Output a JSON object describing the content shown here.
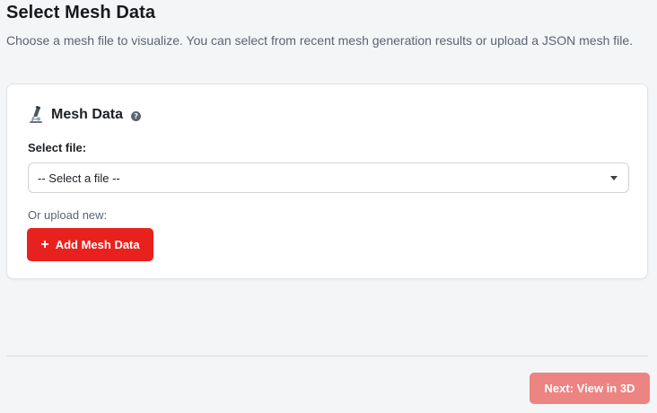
{
  "page": {
    "title": "Select Mesh Data",
    "description": "Choose a mesh file to visualize. You can select from recent mesh generation results or upload a JSON mesh file."
  },
  "card": {
    "icon": "microscope-icon",
    "title": "Mesh Data",
    "help_icon": "question-circle-icon",
    "help_glyph": "?",
    "select_label": "Select file:",
    "select_value": "-- Select a file --",
    "upload_label": "Or upload new:",
    "add_button_icon": "plus-icon",
    "add_button_glyph": "+",
    "add_button_label": "Add Mesh Data"
  },
  "footer": {
    "next_button_label": "Next: View in 3D"
  },
  "colors": {
    "primary": "#e8211e",
    "primary_disabled": "#ec8482",
    "background": "#f4f5f7"
  }
}
